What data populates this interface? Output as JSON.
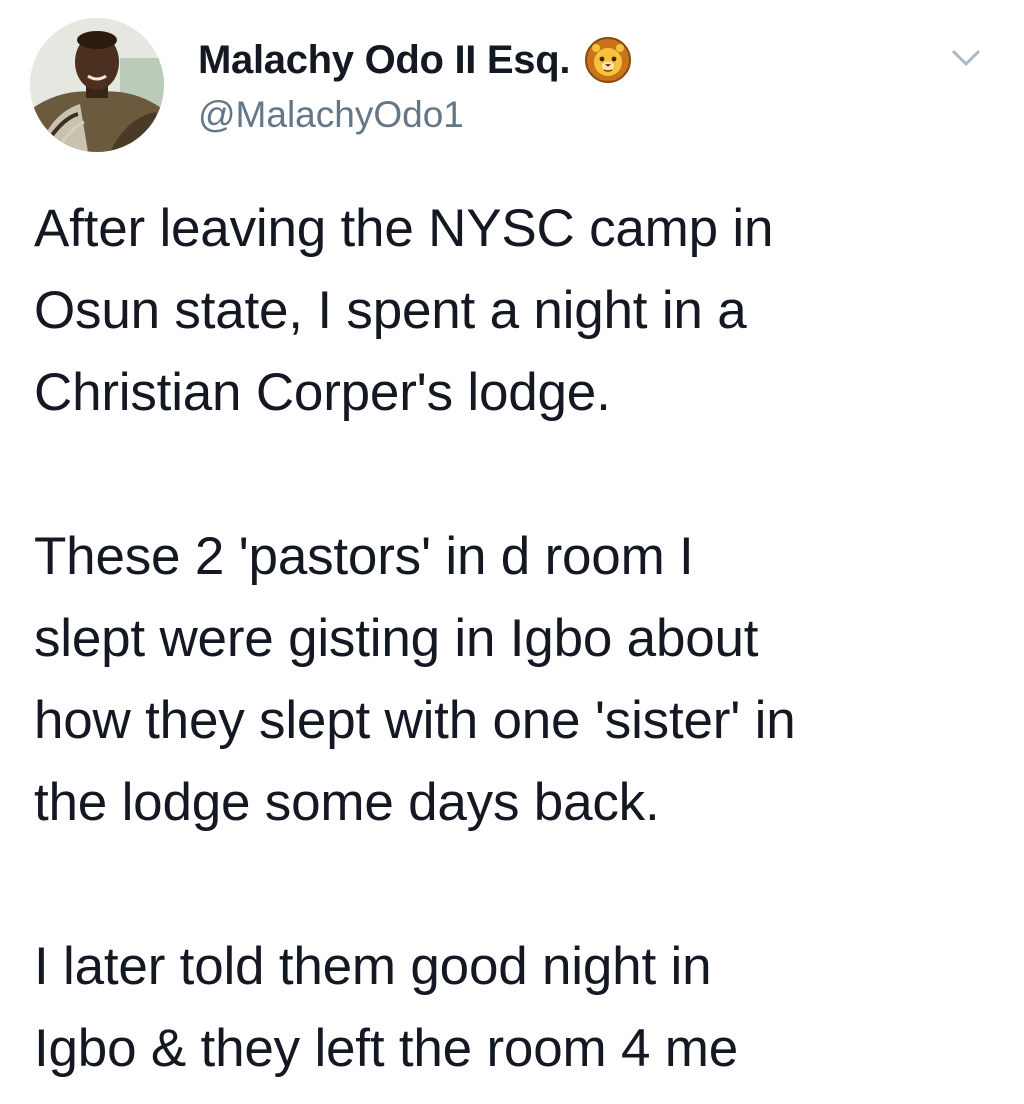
{
  "tweet": {
    "display_name": "Malachy Odo II Esq.",
    "badge_icon": "lion-face-icon",
    "handle": "@MalachyOdo1",
    "menu_icon": "chevron-down-icon",
    "paragraphs": [
      "After leaving the NYSC camp in\nOsun state, I spent a night in a\nChristian Corper's lodge.",
      "These 2 'pastors' in d room I\nslept were gisting in Igbo about\nhow they slept with one 'sister' in\nthe lodge some days back.",
      "I later told them good night in\nIgbo & they left the room 4 me"
    ]
  },
  "colors": {
    "text": "#141823",
    "handle": "#657786",
    "chevron": "#aab8c2"
  }
}
